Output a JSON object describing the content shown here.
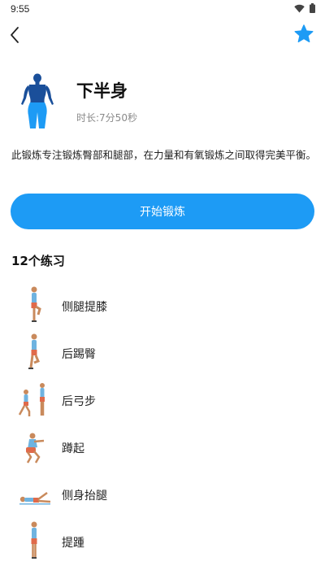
{
  "status_bar": {
    "time": "9:55"
  },
  "header": {
    "back_icon": "chevron-left-icon",
    "favorite_icon": "star-icon",
    "accent_color": "#1d9bf5"
  },
  "workout": {
    "title": "下半身",
    "duration_label": "时长:",
    "duration_value": "7分50秒",
    "description": "此锻炼专注锻炼臀部和腿部，在力量和有氧锻炼之间取得完美平衡。",
    "start_button_label": "开始锻炼"
  },
  "exercises_section": {
    "title": "12个练习",
    "items": [
      {
        "name": "侧腿提膝",
        "thumb": "standing-knee-raise"
      },
      {
        "name": "后踢臀",
        "thumb": "butt-kick"
      },
      {
        "name": "后弓步",
        "thumb": "reverse-lunge"
      },
      {
        "name": "蹲起",
        "thumb": "squat"
      },
      {
        "name": "侧身抬腿",
        "thumb": "side-lying-leg-raise"
      },
      {
        "name": "提踵",
        "thumb": "calf-raise"
      }
    ]
  }
}
